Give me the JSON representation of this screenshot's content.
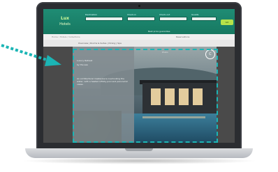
{
  "site": {
    "brand_name": "Lux",
    "brand_tag": "Hotels",
    "labels": [
      "Destination",
      "Check-in",
      "Check-out",
      "Guests"
    ],
    "fields": [
      "",
      "",
      "",
      ""
    ],
    "go": "GO",
    "header_note": "Best price guarantee",
    "breadcrumb": "Home / Hotels / Collections",
    "subbar_right": "Reservations",
    "content_links": "Overview  |  Rooms & Suites  |  Dining  |  Spa",
    "hero": {
      "panel_lines": [
        "Luxury Retreat",
        "by the sea"
      ],
      "panel_copy": "An architectural masterpiece overlooking the water, with a heated infinity pool and panoramic views.",
      "caption": "Photo",
      "logo": "C"
    }
  },
  "colors": {
    "header": "#1f8c74",
    "accent": "#b7e24a",
    "highlight": "#1bb5b5"
  }
}
